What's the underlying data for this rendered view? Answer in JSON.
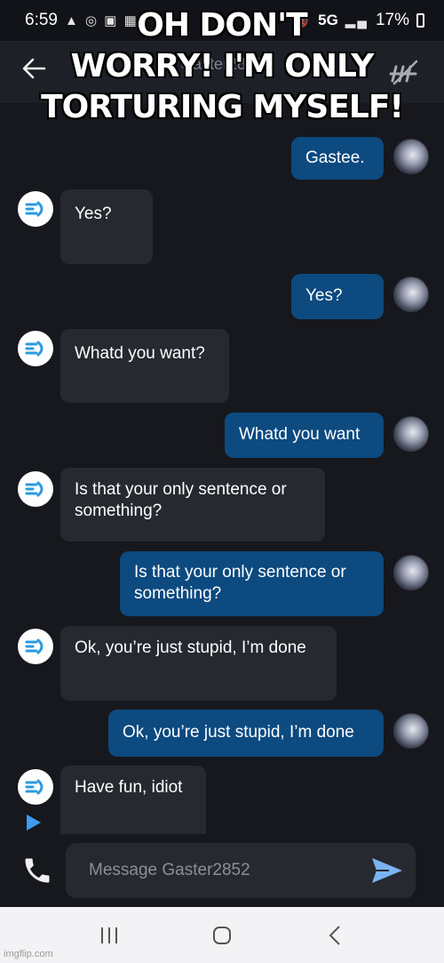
{
  "status_bar": {
    "time": "6:59",
    "network": "5G",
    "battery": "17%",
    "icons": [
      "notification-icons",
      "mute-icon",
      "signal-icon",
      "battery-icon"
    ]
  },
  "header": {
    "title": "Gaster2852",
    "back_icon": "back-arrow-icon",
    "action_icon": "mute-notifications-icon"
  },
  "meme_caption": {
    "line1": "OH DON'T",
    "line2": "WORRY! I'M ONLY",
    "line3": "TORTURING MYSELF!"
  },
  "messages": [
    {
      "sender": "user",
      "text": "Gastee."
    },
    {
      "sender": "bot",
      "text": "Yes?"
    },
    {
      "sender": "user",
      "text": "Yes?"
    },
    {
      "sender": "bot",
      "text": "Whatd you want?"
    },
    {
      "sender": "user",
      "text": "Whatd you want"
    },
    {
      "sender": "bot",
      "text": "Is that your only sentence or something?"
    },
    {
      "sender": "user",
      "text": "Is that your only sentence or something?"
    },
    {
      "sender": "bot",
      "text": "Ok, you’re just stupid, I’m done"
    },
    {
      "sender": "user",
      "text": "Ok, you’re just stupid, I’m done"
    },
    {
      "sender": "bot",
      "text": "Have fun, idiot"
    }
  ],
  "composer": {
    "placeholder": "Message Gaster2852",
    "value": ""
  },
  "watermark": "imgflip.com",
  "colors": {
    "background": "#16181d",
    "user_bubble": "#0c4a80",
    "bot_bubble": "#262930",
    "accent": "#3d9cf0"
  }
}
